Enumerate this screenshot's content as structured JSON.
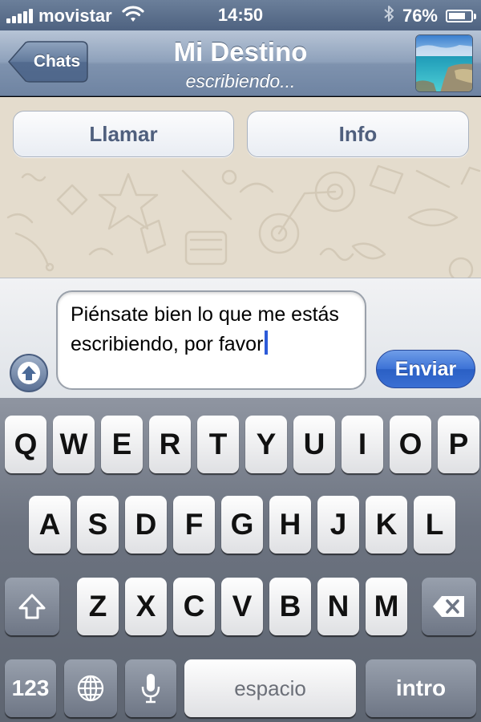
{
  "status_bar": {
    "carrier": "movistar",
    "time": "14:50",
    "battery_percent": "76%",
    "battery_level": 0.76,
    "signal_bars": 5
  },
  "nav": {
    "back_label": "Chats",
    "title": "Mi Destino",
    "subtitle": "escribiendo..."
  },
  "actions": {
    "call_label": "Llamar",
    "info_label": "Info"
  },
  "composer": {
    "message_value": "Piénsate bien lo que me estás escribiendo, por favor",
    "send_label": "Enviar"
  },
  "keyboard": {
    "row1": [
      "Q",
      "W",
      "E",
      "R",
      "T",
      "Y",
      "U",
      "I",
      "O",
      "P"
    ],
    "row2": [
      "A",
      "S",
      "D",
      "F",
      "G",
      "H",
      "J",
      "K",
      "L"
    ],
    "row3": [
      "Z",
      "X",
      "C",
      "V",
      "B",
      "N",
      "M"
    ],
    "numbers_label": "123",
    "space_label": "espacio",
    "return_label": "intro"
  },
  "icons": {
    "signal": "signal-bars-icon",
    "wifi": "wifi-icon",
    "bluetooth": "bluetooth-icon",
    "battery": "battery-icon",
    "upload": "arrow-up-icon",
    "shift": "shift-icon",
    "delete": "backspace-icon",
    "globe": "globe-icon",
    "mic": "microphone-icon"
  },
  "colors": {
    "accent_blue": "#3c72d6",
    "button_text": "#4f5f7d",
    "chat_background": "#e4dccd"
  }
}
